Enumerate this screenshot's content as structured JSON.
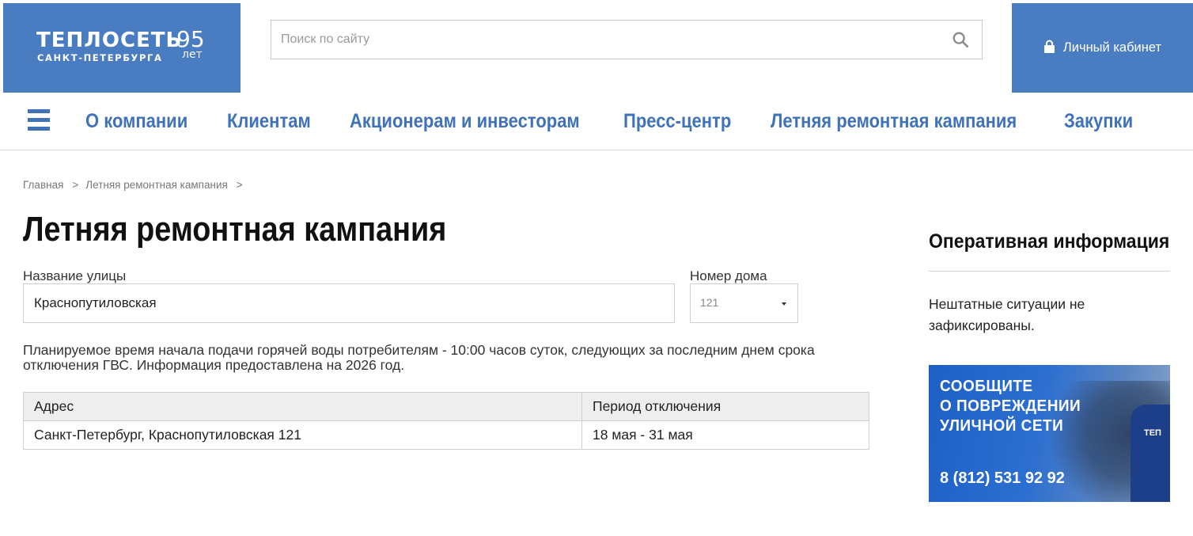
{
  "header": {
    "logo": {
      "name": "ТЕПЛОСЕТЬ",
      "city": "САНКТ-ПЕТЕРБУРГА",
      "years": "95",
      "years_suffix": "лет"
    },
    "search": {
      "placeholder": "Поиск по сайту",
      "value": ""
    },
    "cabinet_label": "Личный кабинет"
  },
  "nav": {
    "items": [
      {
        "label": "О компании"
      },
      {
        "label": "Клиентам"
      },
      {
        "label": "Акционерам и инвесторам"
      },
      {
        "label": "Пресс-центр"
      },
      {
        "label": "Летняя ремонтная кампания"
      },
      {
        "label": "Закупки"
      }
    ]
  },
  "breadcrumb": {
    "items": [
      "Главная",
      "Летняя ремонтная кампания"
    ],
    "separator": ">"
  },
  "main": {
    "title": "Летняя ремонтная кампания",
    "street_label": "Название улицы",
    "street_value": "Краснопутиловская",
    "house_label": "Номер дома",
    "house_value": "121",
    "notice": "Планируемое время начала подачи горячей воды потребителям - 10:00 часов суток, следующих за последним днем срока отключения ГВС. Информация предоставлена на 2026 год.",
    "table": {
      "headers": [
        "Адрес",
        "Период отключения"
      ],
      "rows": [
        [
          "Санкт-Петербург, Краснопутиловская 121",
          "18 мая - 31 мая"
        ]
      ]
    }
  },
  "sidebar": {
    "title": "Оперативная информация",
    "status_text": "Нештатные ситуации не зафиксированы.",
    "banner": {
      "lines": [
        "СООБЩИТЕ",
        "О ПОВРЕЖДЕНИИ",
        "УЛИЧНОЙ СЕТИ"
      ],
      "phone": "8 (812) 531 92 92",
      "chair_logo": "ТЕП"
    }
  },
  "colors": {
    "brand": "#4a7cc2",
    "nav_text": "#3f72b8"
  }
}
